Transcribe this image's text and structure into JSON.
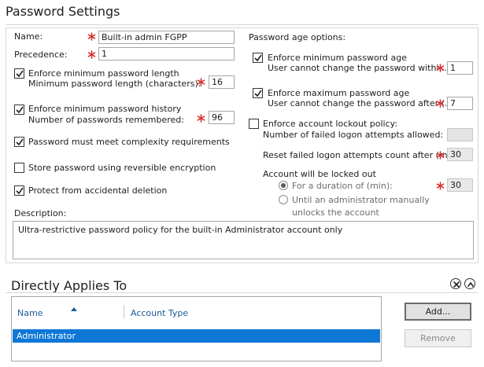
{
  "password_settings": {
    "title": "Password Settings",
    "name_label": "Name:",
    "name_value": "Built-in admin FGPP",
    "precedence_label": "Precedence:",
    "precedence_value": "1",
    "enforce_min_length_label": "Enforce minimum password length",
    "min_length_label": "Minimum password length (characters):",
    "min_length_value": "16",
    "enforce_history_label": "Enforce minimum password history",
    "history_label": "Number of passwords remembered:",
    "history_value": "96",
    "complexity_label": "Password must meet complexity requirements",
    "reversible_label": "Store password using reversible encryption",
    "protect_label": "Protect from accidental deletion",
    "description_label": "Description:",
    "description_value": "Ultra-restrictive password policy for the built-in Administrator account only",
    "age_options_label": "Password age options:",
    "enforce_min_age_label": "Enforce minimum password age",
    "min_age_sub_label": "User cannot change the password withi...",
    "min_age_value": "1",
    "enforce_max_age_label": "Enforce maximum password age",
    "max_age_sub_label": "User cannot change the password after (...",
    "max_age_value": "7",
    "lockout_label": "Enforce account lockout policy:",
    "failed_attempts_label": "Number of failed logon attempts allowed:",
    "failed_attempts_value": "",
    "reset_label": "Reset failed logon attempts count after (m...",
    "reset_value": "30",
    "locked_out_label": "Account will be locked out",
    "duration_label": "For a duration of (min):",
    "duration_value": "30",
    "until_admin_label_1": "Until an administrator manually",
    "until_admin_label_2": "unlocks the account",
    "checks": {
      "enforce_min_length": true,
      "enforce_history": true,
      "complexity": true,
      "reversible": false,
      "protect": true,
      "enforce_min_age": true,
      "enforce_max_age": true,
      "lockout": false
    }
  },
  "applies_to": {
    "title": "Directly Applies To",
    "columns": [
      "Name",
      "Account Type"
    ],
    "rows": [
      {
        "name": "Administrator",
        "type": ""
      }
    ],
    "add_label": "Add...",
    "remove_label": "Remove"
  },
  "colors": {
    "required": "#d8302f",
    "selection": "#0f78d7",
    "header_link": "#1a5a9a"
  },
  "icons": {
    "required": "asterisk-icon",
    "close": "close-circle-icon",
    "collapse": "chevron-up-circle-icon",
    "sort": "sort-ascending-icon"
  }
}
